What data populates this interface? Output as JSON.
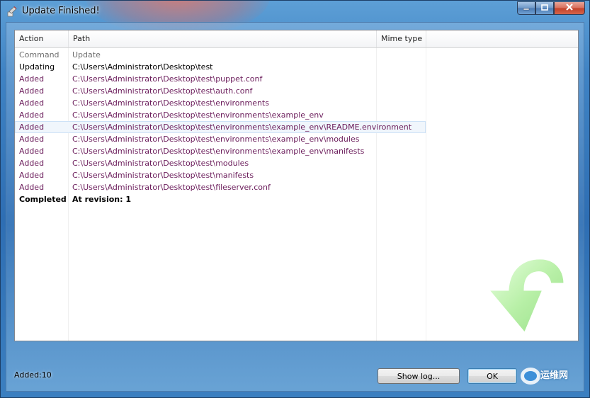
{
  "window": {
    "title": "Update Finished!"
  },
  "caption_buttons": {
    "minimize": "–",
    "maximize": "□",
    "close": "✕"
  },
  "table": {
    "headers": {
      "action": "Action",
      "path": "Path",
      "mime": "Mime type"
    },
    "rows": [
      {
        "action": "Command",
        "path": "Update",
        "style": "gray"
      },
      {
        "action": "Updating",
        "path": "C:\\Users\\Administrator\\Desktop\\test",
        "style": "black"
      },
      {
        "action": "Added",
        "path": "C:\\Users\\Administrator\\Desktop\\test\\puppet.conf",
        "style": "added"
      },
      {
        "action": "Added",
        "path": "C:\\Users\\Administrator\\Desktop\\test\\auth.conf",
        "style": "added"
      },
      {
        "action": "Added",
        "path": "C:\\Users\\Administrator\\Desktop\\test\\environments",
        "style": "added"
      },
      {
        "action": "Added",
        "path": "C:\\Users\\Administrator\\Desktop\\test\\environments\\example_env",
        "style": "added"
      },
      {
        "action": "Added",
        "path": "C:\\Users\\Administrator\\Desktop\\test\\environments\\example_env\\README.environment",
        "style": "added",
        "selected": true
      },
      {
        "action": "Added",
        "path": "C:\\Users\\Administrator\\Desktop\\test\\environments\\example_env\\modules",
        "style": "added"
      },
      {
        "action": "Added",
        "path": "C:\\Users\\Administrator\\Desktop\\test\\environments\\example_env\\manifests",
        "style": "added"
      },
      {
        "action": "Added",
        "path": "C:\\Users\\Administrator\\Desktop\\test\\modules",
        "style": "added"
      },
      {
        "action": "Added",
        "path": "C:\\Users\\Administrator\\Desktop\\test\\manifests",
        "style": "added"
      },
      {
        "action": "Added",
        "path": "C:\\Users\\Administrator\\Desktop\\test\\fileserver.conf",
        "style": "added"
      },
      {
        "action": "Completed",
        "path": "At revision: 1",
        "style": "bold"
      }
    ]
  },
  "status": {
    "text": "Added:10"
  },
  "buttons": {
    "show_log": "Show log...",
    "ok": "OK"
  },
  "watermark": {
    "text": "运维网"
  },
  "colors": {
    "added_text": "#6a1b5a",
    "selection": "#f0f6fc",
    "arrow": "#b6f0a4"
  },
  "icons": {
    "title": "update-icon",
    "decoration": "curved-down-arrow-icon"
  }
}
